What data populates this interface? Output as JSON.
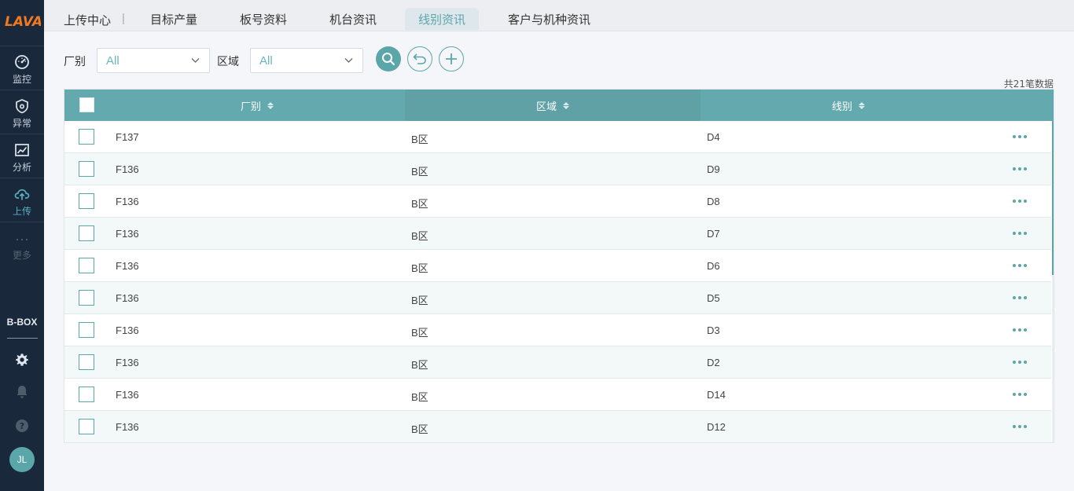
{
  "brand": {
    "logo_text": "LAVA"
  },
  "sidebar": {
    "items": [
      {
        "label": "监控",
        "icon": "dashboard-gauge-icon"
      },
      {
        "label": "异常",
        "icon": "shield-alert-icon"
      },
      {
        "label": "分析",
        "icon": "line-chart-icon"
      },
      {
        "label": "上传",
        "icon": "cloud-upload-icon"
      },
      {
        "label": "更多",
        "icon": "ellipsis-icon"
      }
    ],
    "active": "上传",
    "box_label": "B-BOX",
    "user_initials": "JL"
  },
  "topbar": {
    "crumb": "上传中心",
    "separator": "|",
    "tabs": [
      {
        "label": "目标产量"
      },
      {
        "label": "板号资料"
      },
      {
        "label": "机台资讯"
      },
      {
        "label": "线别资讯"
      },
      {
        "label": "客户与机种资讯"
      }
    ],
    "active_tab": "线别资讯"
  },
  "filters": {
    "factory": {
      "label": "厂别",
      "value": "All"
    },
    "area": {
      "label": "区域",
      "value": "All"
    },
    "buttons": [
      "search-icon",
      "reset-icon",
      "add-icon"
    ]
  },
  "table": {
    "total_text": "共21笔数据",
    "columns": [
      "厂别",
      "区域",
      "线别"
    ],
    "rows": [
      {
        "factory": "F137",
        "area": "B区",
        "line": "D4"
      },
      {
        "factory": "F136",
        "area": "B区",
        "line": "D9"
      },
      {
        "factory": "F136",
        "area": "B区",
        "line": "D8"
      },
      {
        "factory": "F136",
        "area": "B区",
        "line": "D7"
      },
      {
        "factory": "F136",
        "area": "B区",
        "line": "D6"
      },
      {
        "factory": "F136",
        "area": "B区",
        "line": "D5"
      },
      {
        "factory": "F136",
        "area": "B区",
        "line": "D3"
      },
      {
        "factory": "F136",
        "area": "B区",
        "line": "D2"
      },
      {
        "factory": "F136",
        "area": "B区",
        "line": "D14"
      },
      {
        "factory": "F136",
        "area": "B区",
        "line": "D12"
      }
    ]
  },
  "colors": {
    "accent": "#5ba6a9",
    "sidebar_bg": "#19283a",
    "header_bg": "#64a9ad"
  }
}
